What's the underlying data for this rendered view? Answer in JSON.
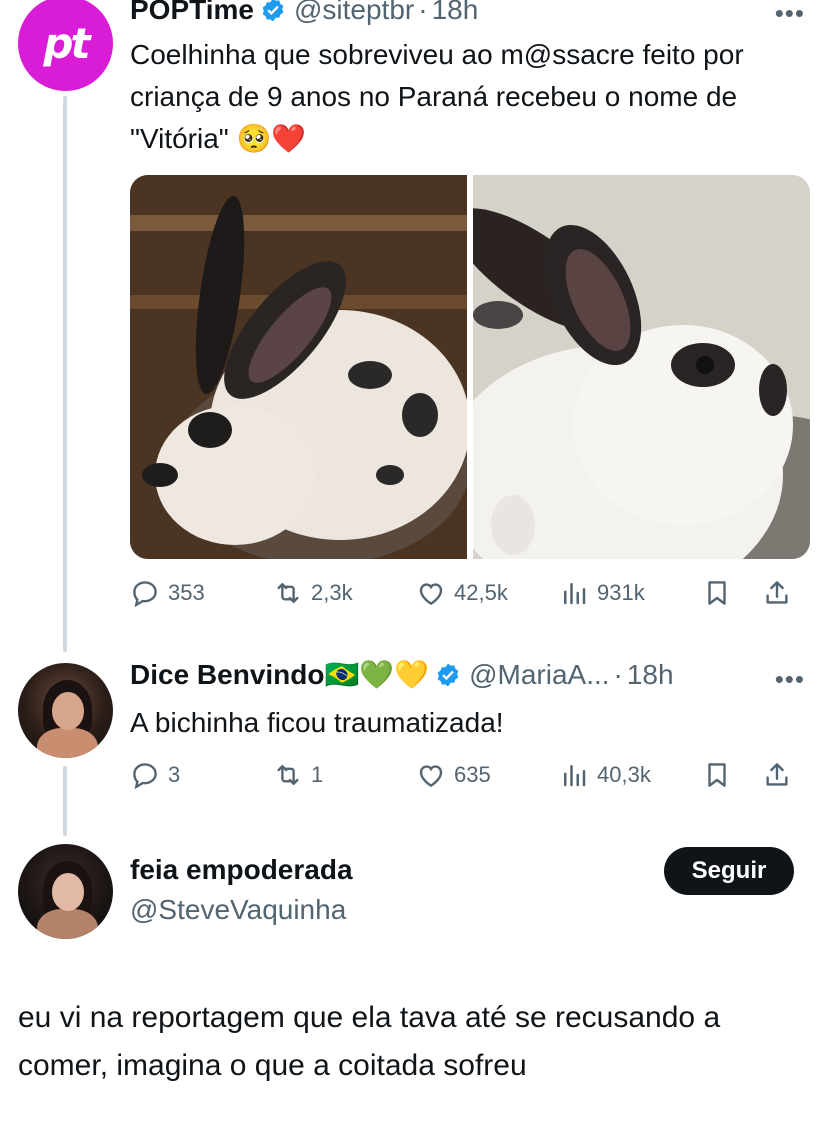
{
  "tweet1": {
    "avatar_text": "pt",
    "name": "POPTime",
    "handle": "@siteptbr",
    "time": "18h",
    "text": "Coelhinha que sobreviveu ao m@ssacre feito por criança de 9 anos no Paraná recebeu o nome de \"Vitória\" 🥺❤️",
    "stats": {
      "replies": "353",
      "retweets": "2,3k",
      "likes": "42,5k",
      "views": "931k"
    }
  },
  "tweet2": {
    "name": "Dice Benvindo🇧🇷💚💛",
    "handle": "@MariaA...",
    "time": "18h",
    "text": "A bichinha ficou traumatizada!",
    "stats": {
      "replies": "3",
      "retweets": "1",
      "likes": "635",
      "views": "40,3k"
    }
  },
  "tweet3": {
    "name": "feia empoderada",
    "handle": "@SteveVaquinha",
    "follow_label": "Seguir",
    "text": "eu vi na reportagem que ela tava até se recusando a comer, imagina o que a coitada sofreu"
  },
  "colors": {
    "verified": "#1d9bf0",
    "secondary_text": "#536471",
    "thread_line": "#cfd9de"
  },
  "icons": [
    "verified-icon",
    "more-icon",
    "reply-icon",
    "retweet-icon",
    "like-icon",
    "views-icon",
    "bookmark-icon",
    "share-icon"
  ]
}
